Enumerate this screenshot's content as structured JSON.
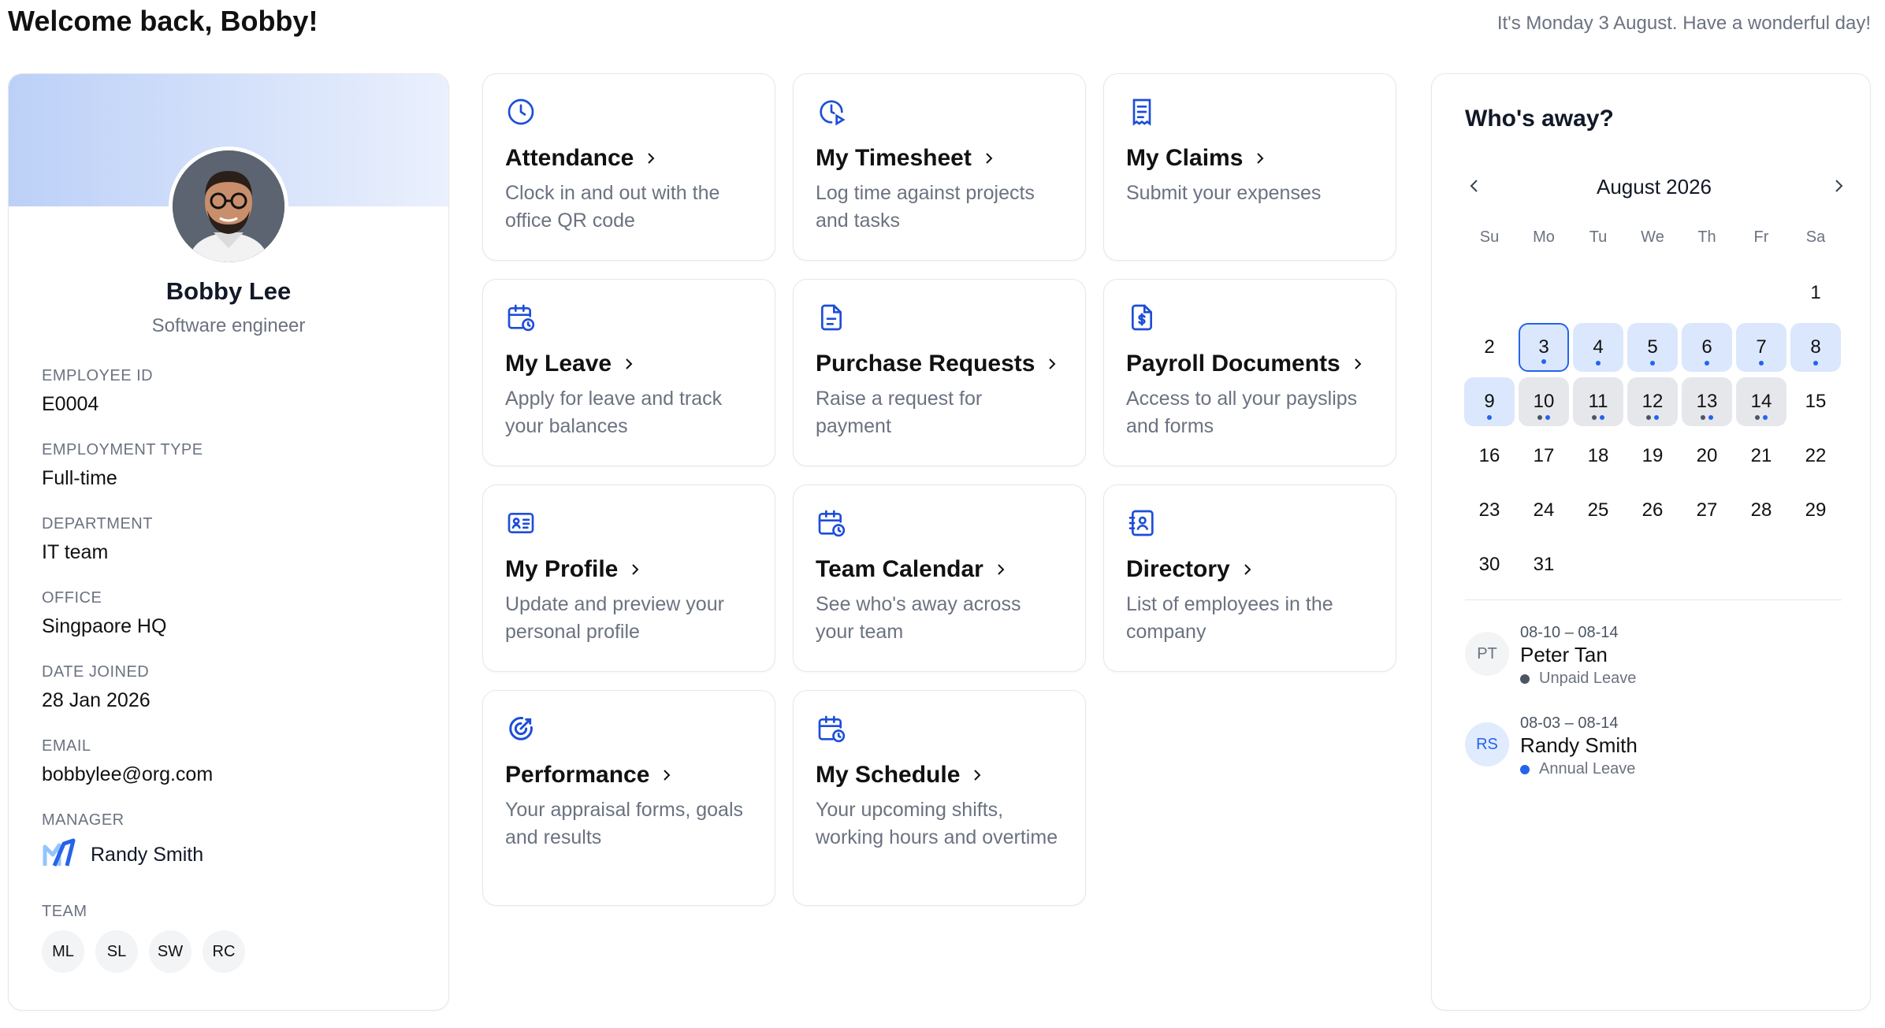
{
  "header": {
    "title": "Welcome back, Bobby!",
    "greeting": "It's Monday 3 August. Have a wonderful day!"
  },
  "profile": {
    "name": "Bobby Lee",
    "role": "Software engineer",
    "fields": {
      "employee_id": {
        "label": "EMPLOYEE ID",
        "value": "E0004"
      },
      "employment_type": {
        "label": "EMPLOYMENT TYPE",
        "value": "Full-time"
      },
      "department": {
        "label": "DEPARTMENT",
        "value": "IT team"
      },
      "office": {
        "label": "OFFICE",
        "value": "Singpaore HQ"
      },
      "date_joined": {
        "label": "DATE JOINED",
        "value": "28 Jan 2026"
      },
      "email": {
        "label": "EMAIL",
        "value": "bobbylee@org.com"
      }
    },
    "manager": {
      "label": "MANAGER",
      "name": "Randy Smith"
    },
    "team": {
      "label": "TEAM",
      "members": [
        "ML",
        "SL",
        "SW",
        "RC"
      ]
    }
  },
  "tiles": [
    {
      "icon": "clock-icon",
      "title": "Attendance",
      "desc": "Clock in and out with the office QR code"
    },
    {
      "icon": "clock-play-icon",
      "title": "My Timesheet",
      "desc": "Log time against projects and tasks"
    },
    {
      "icon": "receipt-icon",
      "title": "My Claims",
      "desc": "Submit your expenses"
    },
    {
      "icon": "calendar-clock-icon",
      "title": "My Leave",
      "desc": "Apply for leave and track your balances"
    },
    {
      "icon": "document-icon",
      "title": "Purchase Requests",
      "desc": "Raise a request for payment"
    },
    {
      "icon": "dollar-document-icon",
      "title": "Payroll Documents",
      "desc": "Access to all your payslips and forms"
    },
    {
      "icon": "id-card-icon",
      "title": "My Profile",
      "desc": "Update and preview your personal profile"
    },
    {
      "icon": "calendar-clock-icon",
      "title": "Team Calendar",
      "desc": "See who's away across your team"
    },
    {
      "icon": "contact-book-icon",
      "title": "Directory",
      "desc": "List of employees in the company"
    },
    {
      "icon": "target-icon",
      "title": "Performance",
      "desc": "Your appraisal forms, goals and results"
    },
    {
      "icon": "calendar-clock-icon",
      "title": "My Schedule",
      "desc": "Your upcoming shifts, working hours and overtime"
    }
  ],
  "calendar": {
    "heading": "Who's away?",
    "month": "August 2026",
    "weekdays": [
      "Su",
      "Mo",
      "Tu",
      "We",
      "Th",
      "Fr",
      "Sa"
    ],
    "first_weekday_index": 6,
    "days_in_month": 31,
    "selected_day": 3,
    "highlight_colors": {
      "blue": "#dbe7fd",
      "gray": "#e5e7eb",
      "selected_border": "#2563eb"
    },
    "marked_days": [
      {
        "day": 3,
        "style": "selected",
        "dots": [
          "b"
        ]
      },
      {
        "day": 4,
        "style": "blue",
        "dots": [
          "b"
        ]
      },
      {
        "day": 5,
        "style": "blue",
        "dots": [
          "b"
        ]
      },
      {
        "day": 6,
        "style": "blue",
        "dots": [
          "b"
        ]
      },
      {
        "day": 7,
        "style": "blue",
        "dots": [
          "b"
        ]
      },
      {
        "day": 8,
        "style": "blue",
        "dots": [
          "b"
        ]
      },
      {
        "day": 9,
        "style": "blue",
        "dots": [
          "b"
        ]
      },
      {
        "day": 10,
        "style": "gray",
        "dots": [
          "g",
          "b"
        ]
      },
      {
        "day": 11,
        "style": "gray",
        "dots": [
          "g",
          "b"
        ]
      },
      {
        "day": 12,
        "style": "gray",
        "dots": [
          "g",
          "b"
        ]
      },
      {
        "day": 13,
        "style": "gray",
        "dots": [
          "g",
          "b"
        ]
      },
      {
        "day": 14,
        "style": "gray",
        "dots": [
          "g",
          "b"
        ]
      }
    ]
  },
  "away_list": [
    {
      "initials": "PT",
      "dates": "08-10 – 08-14",
      "name": "Peter Tan",
      "type": "Unpaid Leave",
      "dot_color": "#4b5563",
      "avatar_bg": "#f3f4f6",
      "avatar_fg": "#6b7280"
    },
    {
      "initials": "RS",
      "dates": "08-03 – 08-14",
      "name": "Randy Smith",
      "type": "Annual Leave",
      "dot_color": "#2563eb",
      "avatar_bg": "#e0ebfd",
      "avatar_fg": "#2563eb"
    }
  ]
}
